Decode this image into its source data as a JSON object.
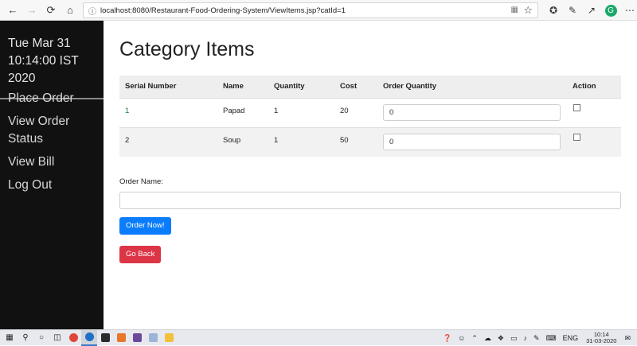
{
  "browser": {
    "url": "localhost:8080/Restaurant-Food-Ordering-System/ViewItems.jsp?catId=1",
    "profile_initial": "G"
  },
  "sidebar": {
    "date": "Tue Mar 31",
    "time": "10:14:00 IST 2020",
    "nav": [
      "Place Order",
      "View Order Status",
      "View Bill",
      "Log Out"
    ]
  },
  "page": {
    "title": "Category Items",
    "columns": [
      "Serial Number",
      "Name",
      "Quantity",
      "Cost",
      "Order Quantity",
      "Action"
    ],
    "rows": [
      {
        "serial": "1",
        "name": "Papad",
        "quantity": "1",
        "cost": "20",
        "order_quantity": "0",
        "checked": false
      },
      {
        "serial": "2",
        "name": "Soup",
        "quantity": "1",
        "cost": "50",
        "order_quantity": "0",
        "checked": false
      }
    ],
    "order_name_label": "Order Name:",
    "order_name_value": "",
    "order_button": "Order Now!",
    "back_button": "Go Back"
  },
  "colors": {
    "sidebar_bg": "#111111",
    "primary": "#0b7dfb",
    "danger": "#dc3545"
  },
  "taskbar": {
    "language": "ENG",
    "time": "10:14",
    "date": "31-03-2020"
  }
}
